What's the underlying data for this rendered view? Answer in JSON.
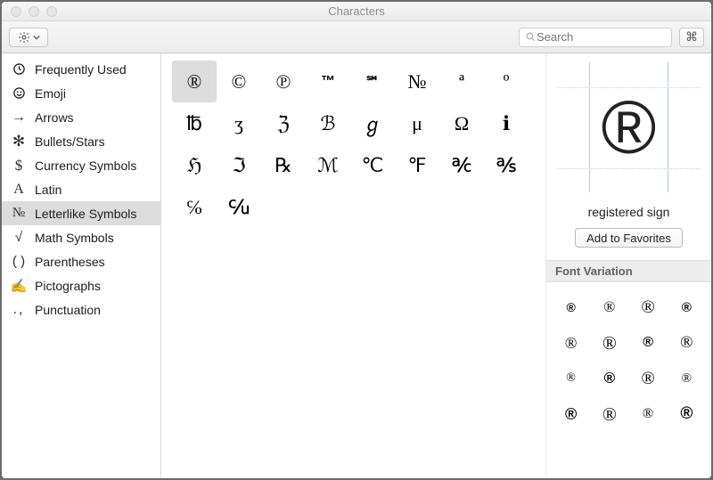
{
  "window": {
    "title": "Characters"
  },
  "toolbar": {
    "searchPlaceholder": "Search"
  },
  "sidebar": {
    "items": [
      {
        "icon": "clock",
        "label": "Frequently Used"
      },
      {
        "icon": "smile",
        "label": "Emoji"
      },
      {
        "icon": "arrow",
        "label": "Arrows"
      },
      {
        "icon": "asterisk",
        "label": "Bullets/Stars"
      },
      {
        "icon": "dollar",
        "label": "Currency Symbols"
      },
      {
        "icon": "latinA",
        "label": "Latin"
      },
      {
        "icon": "numero",
        "label": "Letterlike Symbols"
      },
      {
        "icon": "sqrt",
        "label": "Math Symbols"
      },
      {
        "icon": "parens",
        "label": "Parentheses"
      },
      {
        "icon": "pen",
        "label": "Pictographs"
      },
      {
        "icon": "punct",
        "label": "Punctuation"
      }
    ],
    "selectedIndex": 6
  },
  "grid": {
    "selectedIndex": 0,
    "chars": [
      "®",
      "©",
      "℗",
      "™",
      "℠",
      "№",
      "ª",
      "º",
      "℔",
      "ʒ",
      "ℨ",
      "ℬ",
      "ℊ",
      "μ",
      "Ω",
      "ℹ",
      "ℌ",
      "ℑ",
      "℞",
      "ℳ",
      "℃",
      "℉",
      "℀",
      "℁",
      "℅",
      "℆"
    ]
  },
  "detail": {
    "glyph": "®",
    "name": "registered sign",
    "addFavLabel": "Add to Favorites",
    "fontVariationLabel": "Font Variation",
    "variations": [
      "®",
      "®",
      "®",
      "®",
      "®",
      "®",
      "®",
      "®",
      "®",
      "®",
      "®",
      "®",
      "®",
      "®",
      "®",
      "®"
    ]
  }
}
